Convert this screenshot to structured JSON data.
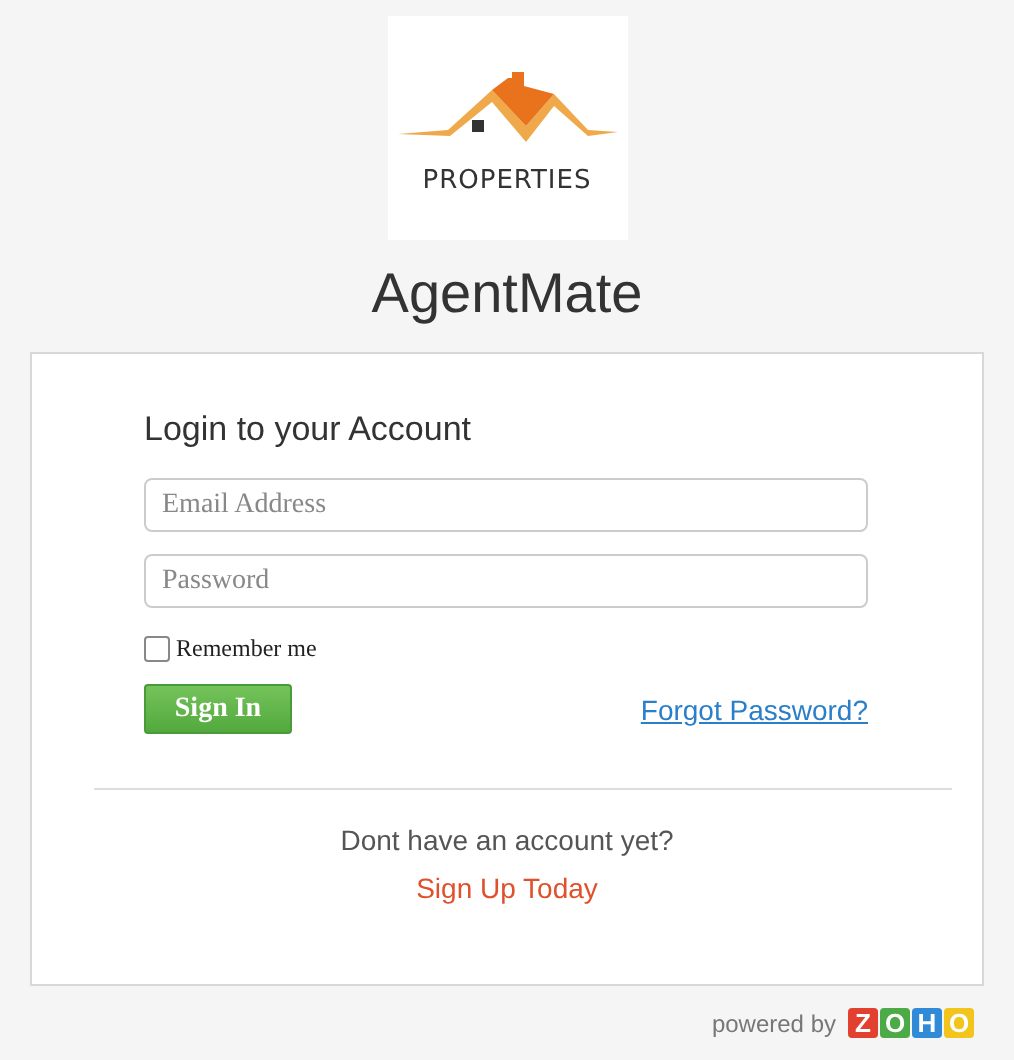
{
  "logo": {
    "text": "PROPERTIES"
  },
  "app_title": "AgentMate",
  "login": {
    "heading": "Login to your Account",
    "fields": [
      {
        "placeholder": "Email Address"
      },
      {
        "placeholder": "Password"
      }
    ],
    "remember": {
      "label": "Remember me",
      "checked": false
    },
    "sign_in": "Sign In",
    "forgot": "Forgot Password?"
  },
  "signup": {
    "prompt": "Dont have an account yet?",
    "link": "Sign Up Today"
  },
  "footer": {
    "powered_by": "powered by",
    "brand_letters": [
      {
        "letter": "Z",
        "color": "#e2412f"
      },
      {
        "letter": "O",
        "color": "#4caa47"
      },
      {
        "letter": "H",
        "color": "#2f8ad8"
      },
      {
        "letter": "O",
        "color": "#f2c41c"
      }
    ]
  }
}
